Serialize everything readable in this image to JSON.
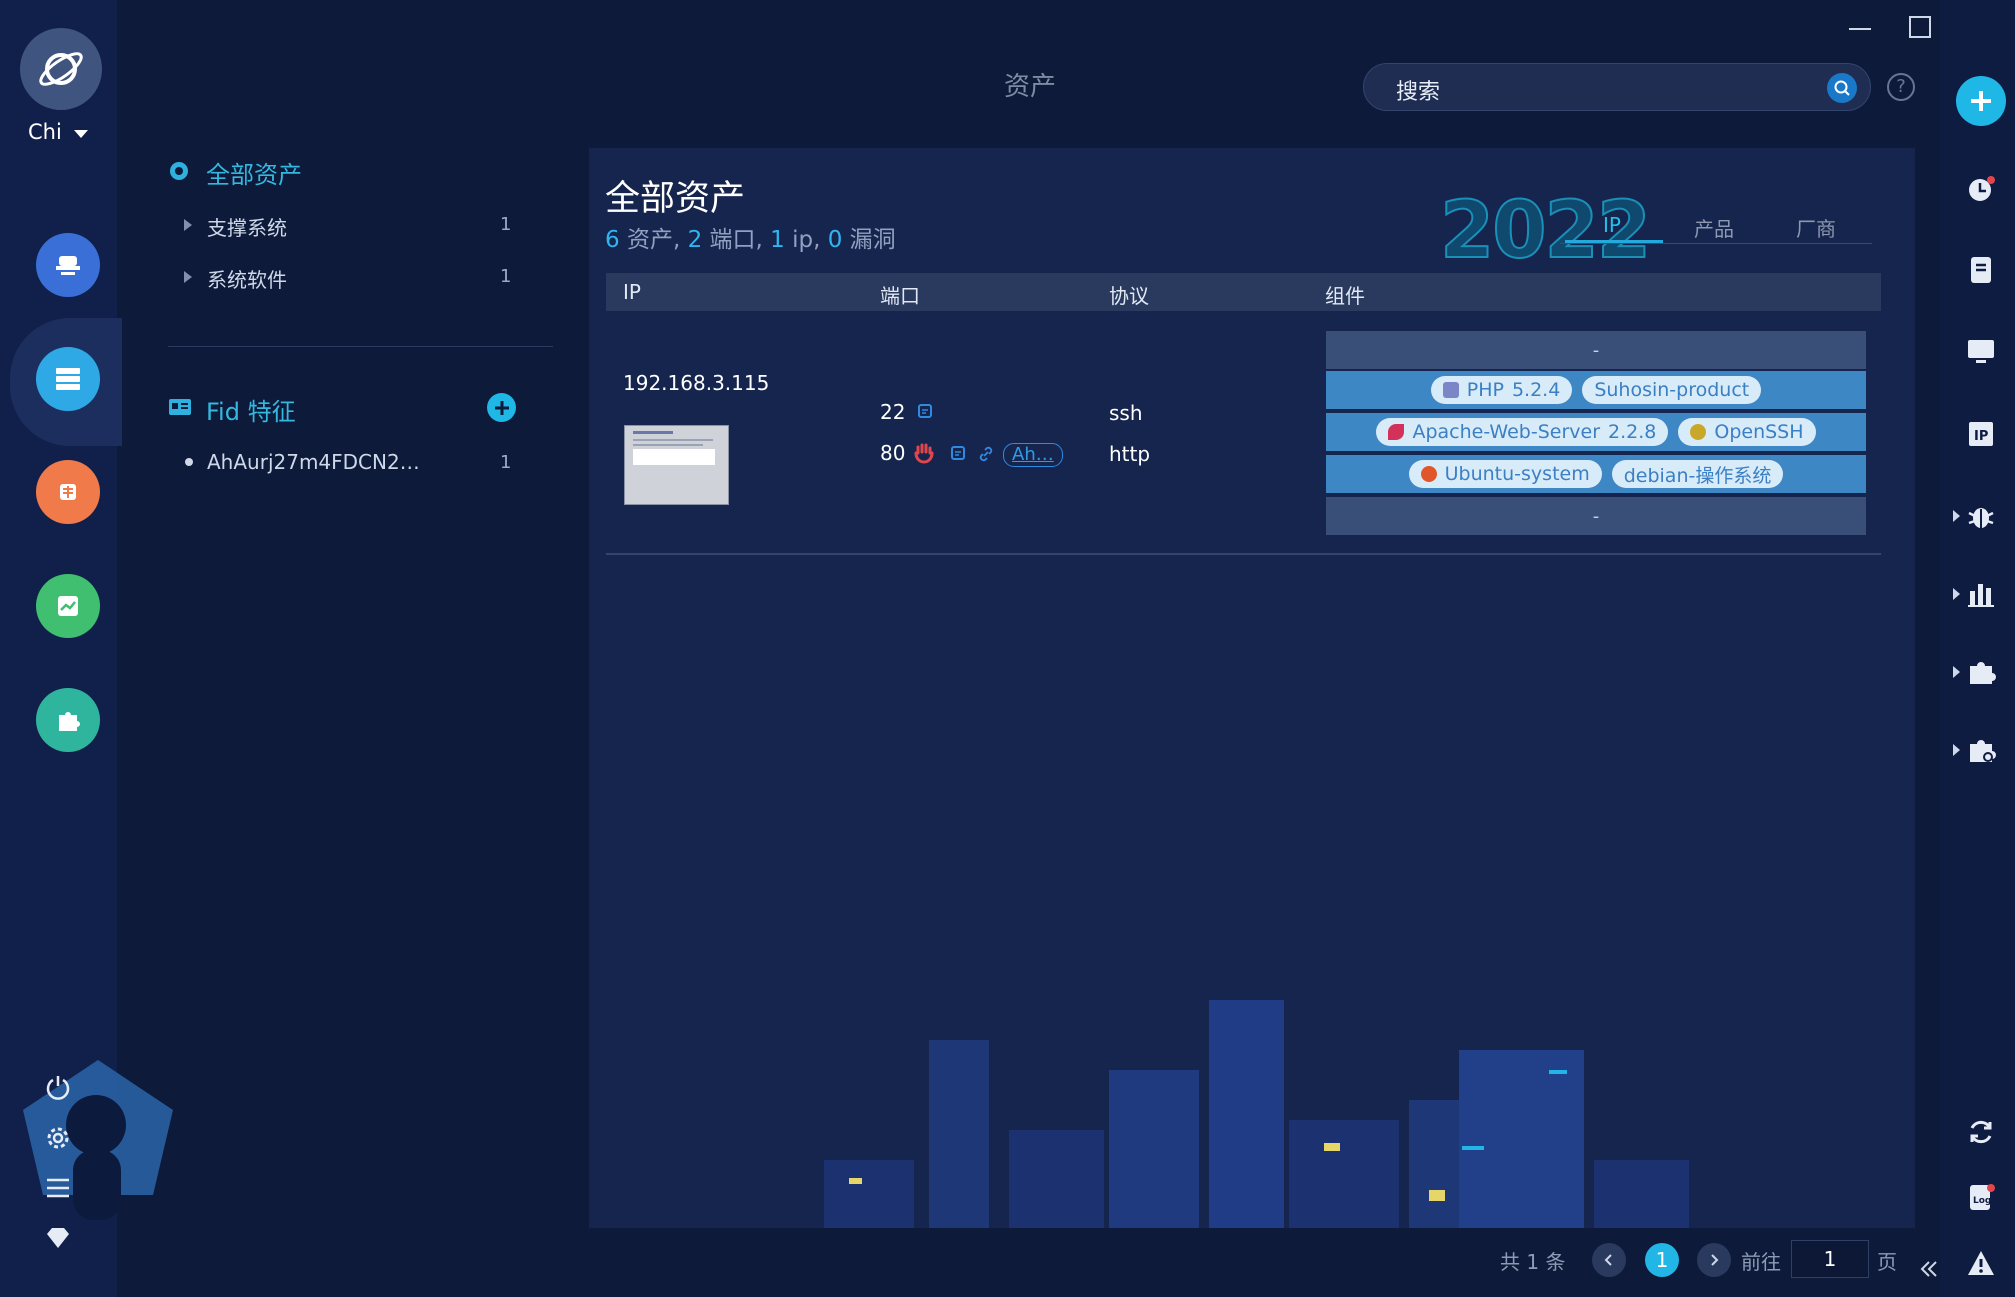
{
  "user": {
    "name": "Chi"
  },
  "header": {
    "title": "资产",
    "search_placeholder": "搜索"
  },
  "tree": {
    "root_label": "全部资产",
    "items": [
      {
        "label": "支撑系统",
        "count": "1"
      },
      {
        "label": "系统软件",
        "count": "1"
      }
    ],
    "fid_section": {
      "label": "Fid 特征",
      "items": [
        {
          "label": "AhAurj27m4FDCN2…",
          "count": "1"
        }
      ]
    }
  },
  "main": {
    "title": "全部资产",
    "stats": {
      "assets": "6",
      "assets_label": " 资产, ",
      "ports": "2",
      "ports_label": " 端口, ",
      "ips": "1",
      "ips_label": " ip, ",
      "vulns": "0",
      "vulns_label": " 漏洞"
    },
    "badge": "2022",
    "tabs": [
      {
        "label": "IP",
        "active": true
      },
      {
        "label": "产品"
      },
      {
        "label": "厂商"
      }
    ],
    "columns": [
      "IP",
      "端口",
      "协议",
      "组件"
    ],
    "rows": [
      {
        "ip": "192.168.3.115",
        "ports": [
          {
            "port": "22",
            "protocol": "ssh"
          },
          {
            "port": "80",
            "protocol": "http",
            "tag": "Ah…"
          }
        ],
        "components": {
          "top_dash": "-",
          "bottom_dash": "-",
          "row1": [
            {
              "name": "PHP",
              "version": "5.2.4"
            },
            {
              "name": "Suhosin-product"
            }
          ],
          "row2": [
            {
              "name": "Apache-Web-Server",
              "version": "2.2.8"
            },
            {
              "name": "OpenSSH"
            }
          ],
          "row3": [
            {
              "name": "Ubuntu-system"
            },
            {
              "name": "debian-操作系统"
            }
          ]
        }
      }
    ]
  },
  "pagination": {
    "total": "共 1 条",
    "current": "1",
    "goto_label": "前往",
    "goto_value": "1",
    "page_unit": "页"
  },
  "colors": {
    "accent": "#22b6e6",
    "background": "#0d1a3a",
    "card": "#16254e",
    "component_row": "#3d87c5"
  }
}
